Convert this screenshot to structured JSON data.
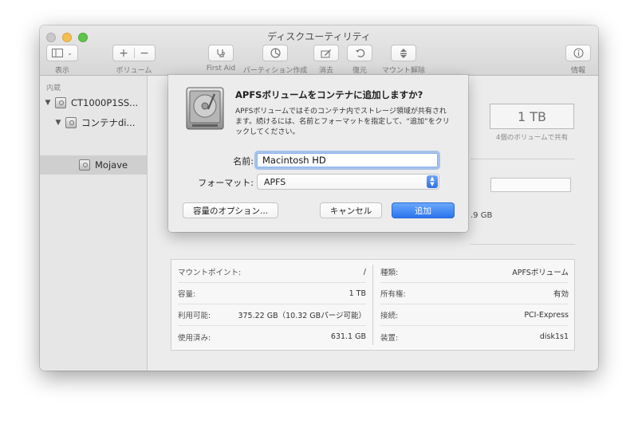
{
  "window": {
    "title": "ディスクユーティリティ"
  },
  "toolbar": {
    "view_label": "表示",
    "volume_label": "ボリューム",
    "volume_add": "+",
    "volume_remove": "−",
    "firstaid_label": "First Aid",
    "partition_label": "パーティション作成",
    "erase_label": "消去",
    "restore_label": "復元",
    "unmount_label": "マウント解除",
    "info_label": "情報"
  },
  "sidebar": {
    "header": "内蔵",
    "items": [
      {
        "label": "CT1000P1SS..."
      },
      {
        "label": "コンテナdi..."
      },
      {
        "label": "Mojave"
      }
    ]
  },
  "main": {
    "capacity": "1 TB",
    "capacity_sub": "4個のボリュームで共有",
    "partial_text": ".9 GB"
  },
  "info": {
    "left": [
      {
        "label": "マウントポイント:",
        "value": "/"
      },
      {
        "label": "容量:",
        "value": "1 TB"
      },
      {
        "label": "利用可能:",
        "value": "375.22 GB（10.32 GBパージ可能）"
      },
      {
        "label": "使用済み:",
        "value": "631.1 GB"
      }
    ],
    "right": [
      {
        "label": "種類:",
        "value": "APFSボリューム"
      },
      {
        "label": "所有権:",
        "value": "有効"
      },
      {
        "label": "接続:",
        "value": "PCI-Express"
      },
      {
        "label": "装置:",
        "value": "disk1s1"
      }
    ]
  },
  "sheet": {
    "title": "APFSボリュームをコンテナに追加しますか?",
    "description": "APFSボリュームではそのコンテナ内でストレージ領域が共有されます。続けるには、名前とフォーマットを指定して、“追加”をクリックしてください。",
    "name_label": "名前:",
    "name_value": "Macintosh HD",
    "format_label": "フォーマット:",
    "format_value": "APFS",
    "options_button": "容量のオプション...",
    "cancel_button": "キャンセル",
    "add_button": "追加"
  },
  "colors": {
    "accent": "#2b74ee",
    "close": "#c9c9c9",
    "minimize": "#f5bf4f",
    "maximize": "#5ec44b"
  }
}
